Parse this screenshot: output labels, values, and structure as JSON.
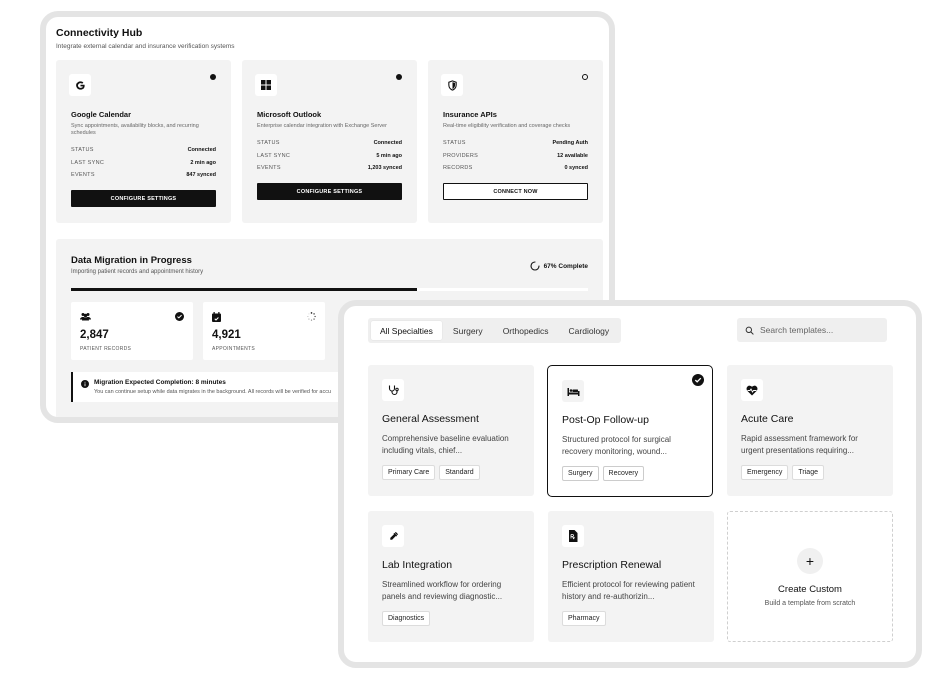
{
  "hub": {
    "title": "Connectivity Hub",
    "subtitle": "Integrate external calendar and insurance verification systems",
    "integrations": [
      {
        "icon": "google-icon",
        "name": "Google Calendar",
        "description": "Sync appointments, availability blocks, and recurring schedules",
        "status_dot": "filled",
        "rows": [
          {
            "label": "STATUS",
            "value": "Connected"
          },
          {
            "label": "LAST SYNC",
            "value": "2 min ago"
          },
          {
            "label": "EVENTS",
            "value": "847 synced"
          }
        ],
        "button": "CONFIGURE SETTINGS",
        "button_style": "filled"
      },
      {
        "icon": "windows-icon",
        "name": "Microsoft Outlook",
        "description": "Enterprise calendar integration with Exchange Server",
        "status_dot": "filled",
        "rows": [
          {
            "label": "STATUS",
            "value": "Connected"
          },
          {
            "label": "LAST SYNC",
            "value": "5 min ago"
          },
          {
            "label": "EVENTS",
            "value": "1,203 synced"
          }
        ],
        "button": "CONFIGURE SETTINGS",
        "button_style": "filled"
      },
      {
        "icon": "shield-icon",
        "name": "Insurance APIs",
        "description": "Real-time eligibility verification and coverage checks",
        "status_dot": "hollow",
        "rows": [
          {
            "label": "STATUS",
            "value": "Pending Auth"
          },
          {
            "label": "PROVIDERS",
            "value": "12 available"
          },
          {
            "label": "RECORDS",
            "value": "0 synced"
          }
        ],
        "button": "CONNECT NOW",
        "button_style": "outline"
      }
    ],
    "migration": {
      "title": "Data Migration in Progress",
      "subtitle": "Importing patient records and appointment history",
      "progress_label": "67% Complete",
      "progress": 0.67,
      "stats": [
        {
          "icon": "users-icon",
          "value": "2,847",
          "label": "PATIENT RECORDS",
          "state": "done"
        },
        {
          "icon": "calendar-icon",
          "value": "4,921",
          "label": "APPOINTMENTS",
          "state": "loading"
        }
      ],
      "notice_title": "Migration Expected Completion: 8 minutes",
      "notice_text": "You can continue setup while data migrates in the background. All records will be verified for accu"
    }
  },
  "templates": {
    "tabs": [
      "All Specialties",
      "Surgery",
      "Orthopedics",
      "Cardiology"
    ],
    "active_tab": 0,
    "search_placeholder": "Search templates...",
    "cards": [
      {
        "icon": "stethoscope-icon",
        "name": "General Assessment",
        "desc": "Comprehensive baseline evaluation including vitals, chief...",
        "tags": [
          "Primary Care",
          "Standard"
        ],
        "selected": false
      },
      {
        "icon": "bed-icon",
        "name": "Post-Op Follow-up",
        "desc": "Structured protocol for surgical recovery monitoring, wound...",
        "tags": [
          "Surgery",
          "Recovery"
        ],
        "selected": true
      },
      {
        "icon": "heart-pulse-icon",
        "name": "Acute Care",
        "desc": "Rapid assessment framework for urgent presentations requiring...",
        "tags": [
          "Emergency",
          "Triage"
        ],
        "selected": false
      },
      {
        "icon": "pipette-icon",
        "name": "Lab Integration",
        "desc": "Streamlined workflow for ordering panels and reviewing diagnostic...",
        "tags": [
          "Diagnostics"
        ],
        "selected": false
      },
      {
        "icon": "prescription-icon",
        "name": "Prescription Renewal",
        "desc": "Efficient protocol for reviewing patient history and re-authorizin...",
        "tags": [
          "Pharmacy"
        ],
        "selected": false
      }
    ],
    "create": {
      "title": "Create Custom",
      "subtitle": "Build a template from scratch",
      "icon": "+"
    }
  }
}
